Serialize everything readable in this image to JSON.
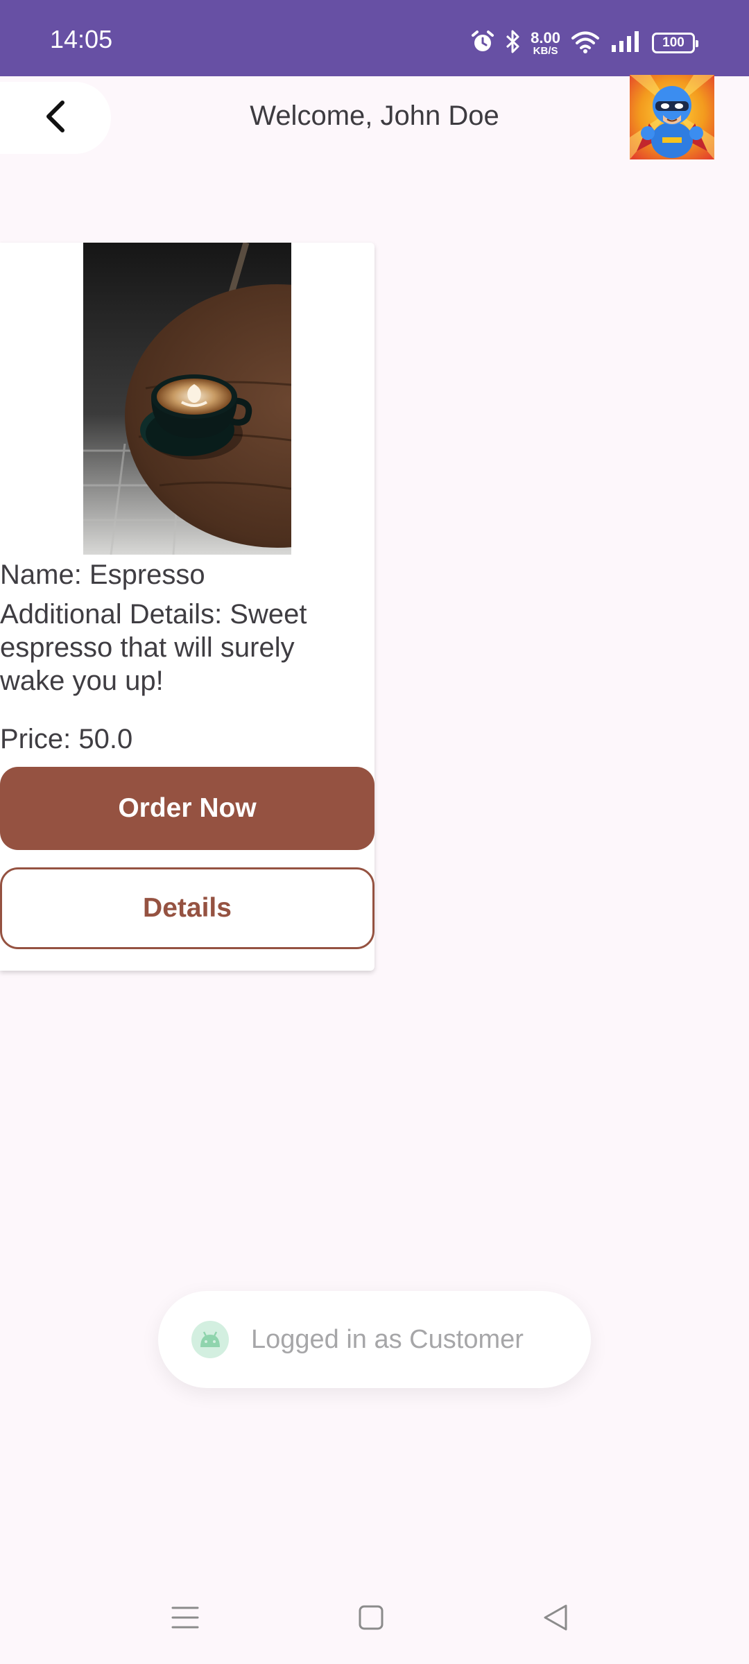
{
  "status_bar": {
    "time": "14:05",
    "network_speed_value": "8.00",
    "network_speed_unit": "KB/S",
    "battery_level": "100",
    "icons": [
      "alarm-icon",
      "bluetooth-icon",
      "wifi-icon",
      "signal-icon",
      "battery-icon"
    ],
    "background_color": "#6750a4"
  },
  "app_bar": {
    "back_icon": "back-arrow-icon",
    "welcome_text": "Welcome, John Doe",
    "avatar_icon": "superhero-avatar"
  },
  "product": {
    "image": "espresso-cup-on-wooden-table",
    "name_line": "Name: Espresso",
    "details_line": "Additional Details: Sweet espresso that will surely wake you up!",
    "price_line": "Price: 50.0",
    "order_button_label": "Order Now",
    "details_button_label": "Details",
    "accent_color": "#955241"
  },
  "toast": {
    "icon": "android-icon",
    "message": "Logged in as Customer"
  },
  "nav_bar": {
    "items": [
      "menu-icon",
      "home-icon",
      "back-icon"
    ]
  }
}
